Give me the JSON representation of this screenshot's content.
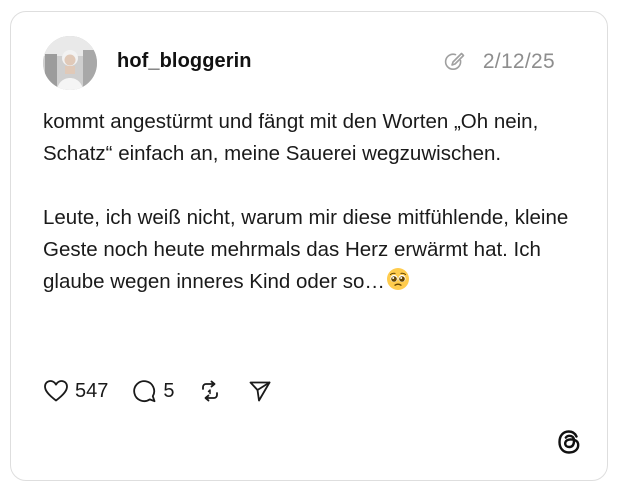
{
  "post": {
    "username": "hof_bloggerin",
    "date": "2/12/25",
    "paragraphs": [
      "kommt angestürmt und fängt mit den Worten „Oh nein, Schatz“ einfach an, meine Sauerei wegzuwischen.",
      "Leute, ich weiß nicht, warum mir diese mitfühlende, kleine Geste noch heute mehrmals das Herz erwärmt hat. Ich glaube wegen inneres Kind oder so…"
    ],
    "emoji": "pleading-face-emoji"
  },
  "actions": {
    "likes": "547",
    "replies": "5"
  },
  "icons": {
    "edited": "edited-icon",
    "like": "heart-icon",
    "reply": "comment-icon",
    "repost": "repost-icon",
    "share": "send-icon",
    "brand": "threads-logo-icon"
  },
  "colors": {
    "text": "#1a1a1a",
    "muted": "#8e8e8e",
    "border": "#dedede",
    "background": "#ffffff"
  }
}
